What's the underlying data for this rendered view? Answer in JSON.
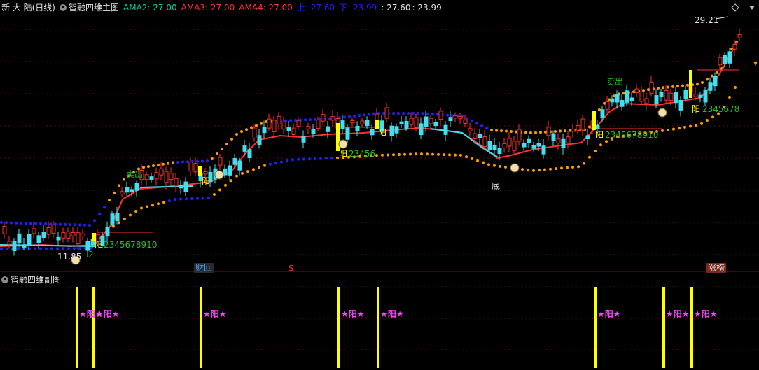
{
  "main_header": {
    "stock_title": "新 大 陆(日线)",
    "indicator_name": "智融四维主图",
    "ama2": "AMA2: 27.00",
    "ama3": "AMA3: 27.00",
    "ama4": "AMA4: 27.00",
    "up": "上: 27.60",
    "down": "下: 23.99",
    "extra_1": ": 27.60",
    "extra_2": ": 23.99"
  },
  "sub_header": {
    "indicator_name": "智融四维副图"
  },
  "chart_labels": {
    "high_price": "29.21",
    "low_price": "11.85",
    "low_label": "底",
    "yang_1": "阳",
    "yang_1_seq": "2345678910",
    "yang_2": "阳",
    "yang_3": "阳",
    "yang_3_seq": "23456",
    "yang_4": "阳",
    "yang_5": "阳",
    "yang_5_seq": "2345678910",
    "yang_6": "阳",
    "yang_6_seq": "2345678",
    "sell_1": "卖出",
    "sell_2": "卖出",
    "two": "2"
  },
  "bottom_tags": {
    "finance_tag": "财回",
    "dollar_tag": "$",
    "limit_up_tag": "涨榜"
  },
  "sub_signals": [
    "★阳★",
    "★阳★",
    "★阳★",
    "★阳★",
    "★阳★",
    "★阳★",
    "★阳★",
    "★阳★"
  ],
  "colors": {
    "ama2": "#00d0a0",
    "ama3": "#ff3030",
    "ama4": "#ff3030",
    "up": "#2020ff",
    "down": "#2020ff",
    "bull": "#ff3030",
    "bear": "#40e0f0",
    "magenta": "#ff40ff",
    "yellow": "#ffff00",
    "orange": "#ff9900",
    "green": "#20c020"
  }
}
